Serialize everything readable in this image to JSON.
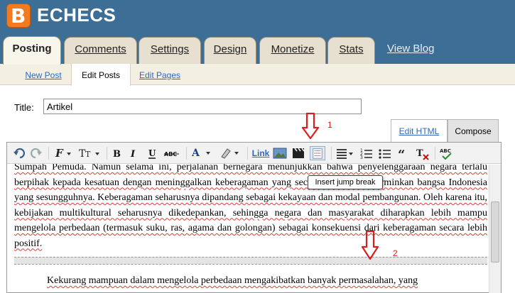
{
  "header": {
    "blog_title": "ECHECS",
    "logo_icon": "blogger-logo-icon",
    "logo_letter": "B"
  },
  "tabs": [
    {
      "label": "Posting",
      "active": true
    },
    {
      "label": "Comments",
      "active": false
    },
    {
      "label": "Settings",
      "active": false
    },
    {
      "label": "Design",
      "active": false
    },
    {
      "label": "Monetize",
      "active": false
    },
    {
      "label": "Stats",
      "active": false
    }
  ],
  "view_blog": "View Blog",
  "subnav": [
    {
      "label": "New Post"
    },
    {
      "label": "Edit Posts"
    },
    {
      "label": "Edit Pages"
    }
  ],
  "title_field": {
    "label": "Title:",
    "value": "Artikel"
  },
  "annotations": {
    "one": "1",
    "two": "2"
  },
  "editor_modes": {
    "edit_html": "Edit HTML",
    "compose": "Compose"
  },
  "toolbar": {
    "link_label": "Link",
    "tooltip": "Insert jump break",
    "icons": [
      "undo-icon",
      "redo-icon",
      "font-icon",
      "font-size-icon",
      "bold-icon",
      "italic-icon",
      "underline-icon",
      "strikethrough-icon",
      "text-color-icon",
      "highlight-icon",
      "image-icon",
      "video-icon",
      "jump-break-icon",
      "align-icon",
      "numbered-list-icon",
      "bullet-list-icon",
      "quote-icon",
      "clear-formatting-icon",
      "spellcheck-icon"
    ]
  },
  "content": {
    "paragraph1": "Sumpah Pemuda. Namun selama ini, perjalanan bernegara menunjukkan bahwa penyelenggaraan negara terlalu berpihak kepada kesatuan dengan meninggalkan keberagaman yang secara faktual mencerminkan bangsa Indonesia yang sesungguhnya. Keberagaman seharusnya dipandang sebagai kekayaan dan modal pembangunan. Oleh karena itu, kebijakan multikultural seharusnya dikedepankan, sehingga negara dan masyarakat diharapkan lebih mampu mengelola perbedaan (termasuk suku, ras, agama dan golongan) sebagai konsekuensi dari keberagaman secara lebih positif.",
    "paragraph2": "Kekurang mampuan dalam mengelola perbedaan mengakibatkan banyak permasalahan, yang"
  },
  "colors": {
    "header_bg": "#3d6e95",
    "logo_orange": "#f27b20",
    "tab_bg": "#e7e0d0",
    "link_blue": "#3366bb",
    "annotation_red": "#d81e1e"
  }
}
